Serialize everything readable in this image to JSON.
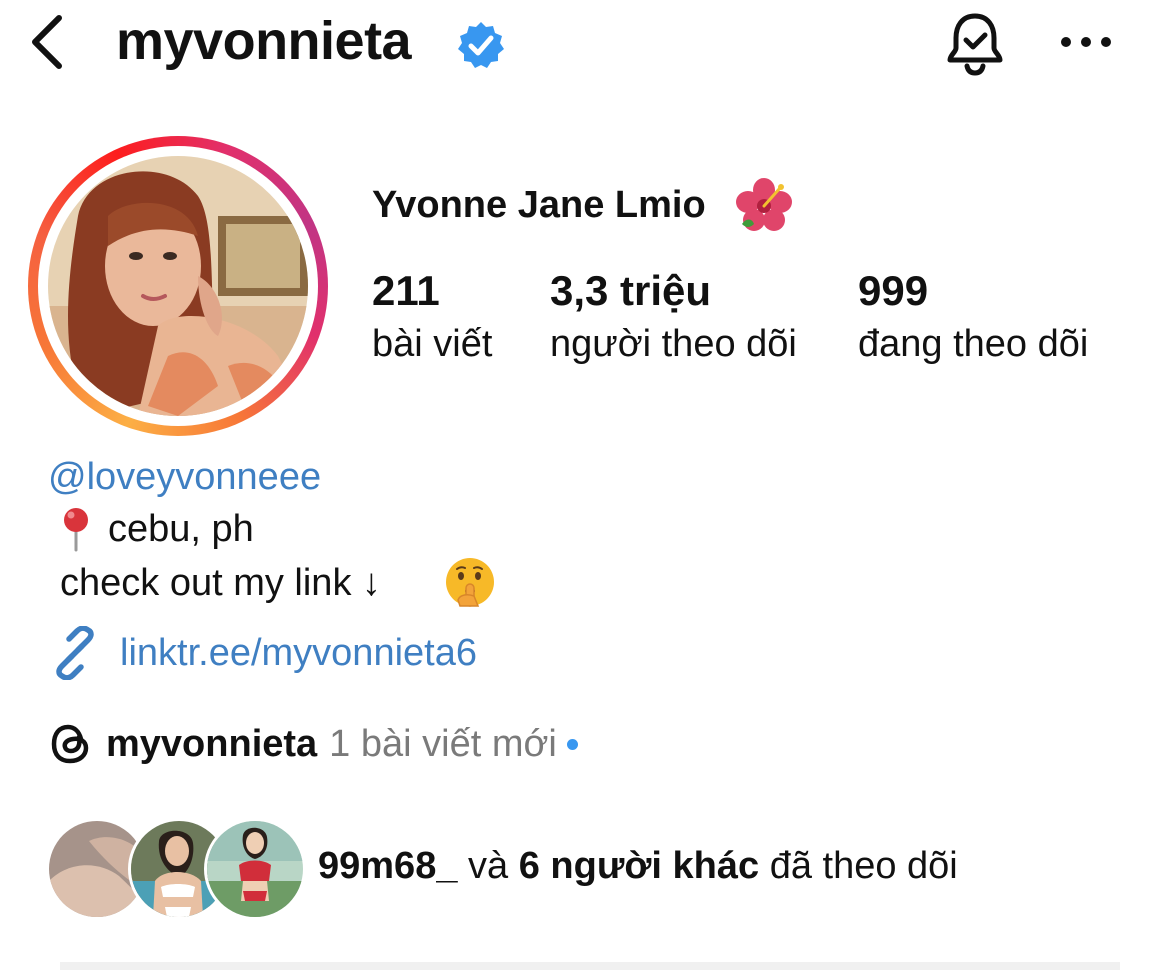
{
  "header": {
    "username": "myvonnieta",
    "back_icon": "chevron-left-icon",
    "verified_icon": "verified-badge-icon",
    "notifications_icon": "bell-check-icon",
    "more_icon": "ellipsis-icon"
  },
  "profile": {
    "display_name": "Yvonne Jane Lmio",
    "display_name_emoji": "hibiscus-icon",
    "stats": [
      {
        "value": "211",
        "label": "bài viết"
      },
      {
        "value": "3,3 triệu",
        "label": "người theo dõi"
      },
      {
        "value": "999",
        "label": "đang theo dõi"
      }
    ]
  },
  "bio": {
    "mention": "@loveyvonneee",
    "location_icon": "round-pushpin-icon",
    "location": "cebu, ph",
    "line": "check out my link ↓",
    "line_emoji": "shushing-face-icon",
    "link_icon": "link-icon",
    "link": "linktr.ee/myvonnieta6"
  },
  "threads": {
    "icon": "threads-icon",
    "handle": "myvonnieta",
    "new_posts": "1 bài viết mới"
  },
  "followed_by": {
    "first_user": "99m68_",
    "conjunction": "và",
    "others": "6 người khác",
    "suffix": "đã theo dõi"
  },
  "colors": {
    "link_blue": "#3f7fc2",
    "verified_blue": "#3897f0",
    "muted_gray": "#7a7a7a"
  }
}
